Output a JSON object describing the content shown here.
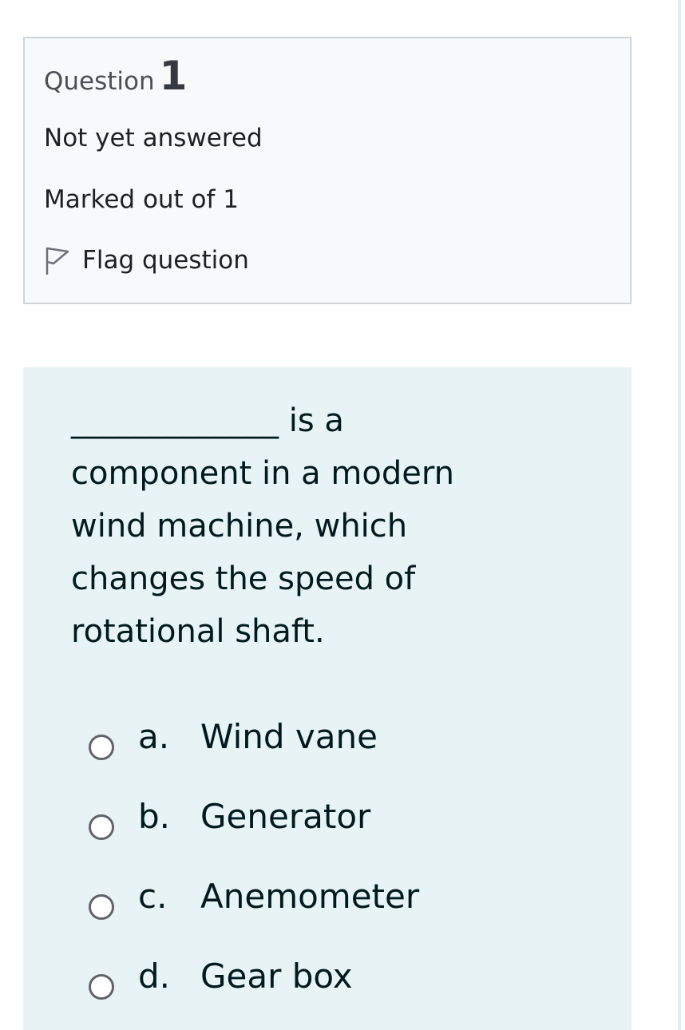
{
  "question_info": {
    "label": "Question",
    "number": "1",
    "state": "Not yet answered",
    "grade": "Marked out of 1",
    "flag_label": "Flag question"
  },
  "question": {
    "text": "_____________ is a component in a modern wind machine, which changes the speed of rotational shaft."
  },
  "answers": [
    {
      "letter": "a.",
      "text": "Wind vane"
    },
    {
      "letter": "b.",
      "text": "Generator"
    },
    {
      "letter": "c.",
      "text": "Anemometer"
    },
    {
      "letter": "d.",
      "text": "Gear box"
    }
  ],
  "icons": {
    "flag": "flag-outline-icon"
  },
  "colors": {
    "info_bg": "#f8f9fa",
    "info_border": "#ced4da",
    "question_bg": "#e7f3f5",
    "text": "#001a1e"
  }
}
